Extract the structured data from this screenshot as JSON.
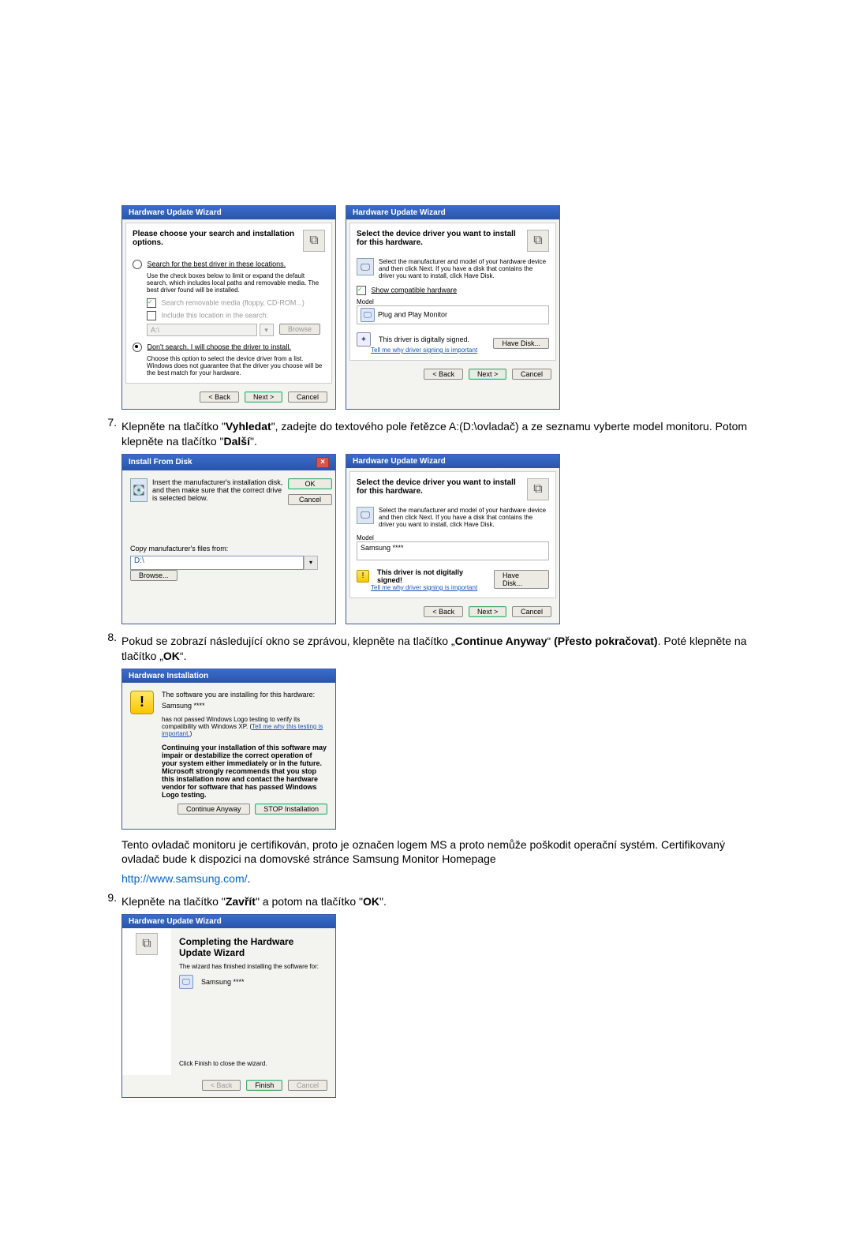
{
  "wizard_title": "Hardware Update Wizard",
  "dlg1": {
    "heading": "Please choose your search and installation options.",
    "opt_search": "Search for the best driver in these locations.",
    "opt_search_help": "Use the check boxes below to limit or expand the default search, which includes local paths and removable media. The best driver found will be installed.",
    "chk_removable": "Search removable media (floppy, CD-ROM...)",
    "chk_include": "Include this location in the search:",
    "path_value": "A:\\",
    "btn_browse": "Browse",
    "opt_dont": "Don't search. I will choose the driver to install.",
    "opt_dont_help": "Choose this option to select the device driver from a list.  Windows does not guarantee that the driver you choose will be the best match for your hardware."
  },
  "dlg2": {
    "heading": "Select the device driver you want to install for this hardware.",
    "help": "Select the manufacturer and model of your hardware device and then click Next. If you have a disk that contains the driver you want to install, click Have Disk.",
    "chk_compat": "Show compatible hardware",
    "model_label": "Model",
    "model_item": "Plug and Play Monitor",
    "signed": "This driver is digitally signed.",
    "tell_me": "Tell me why driver signing is important",
    "have_disk": "Have Disk..."
  },
  "nav": {
    "back": "< Back",
    "next": "Next >",
    "cancel": "Cancel"
  },
  "step7": {
    "num": "7.",
    "text_a": "Klepněte na tlačítko \"",
    "text_b": "Vyhledat",
    "text_c": "\", zadejte do textového pole řetězce A:(D:\\ovladač) a ze seznamu vyberte model monitoru. Potom klepněte na tlačítko \"",
    "text_d": "Další",
    "text_e": "\"."
  },
  "installdisk": {
    "title": "Install From Disk",
    "msg": "Insert the manufacturer's installation disk, and then make sure that the correct drive is selected below.",
    "ok": "OK",
    "cancel": "Cancel",
    "copy_label": "Copy manufacturer's files from:",
    "path": "D:\\",
    "browse": "Browse..."
  },
  "dlg3": {
    "heading": "Select the device driver you want to install for this hardware.",
    "help": "Select the manufacturer and model of your hardware device and then click Next. If you have a disk that contains the driver you want to install, click Have Disk.",
    "model_label": "Model",
    "model_item": "Samsung ****",
    "not_signed": "This driver is not digitally signed!",
    "tell_me": "Tell me why driver signing is important",
    "have_disk": "Have Disk..."
  },
  "step8": {
    "num": "8.",
    "text_a": "Pokud se zobrazí následující okno se zprávou, klepněte na tlačítko ",
    "q1": "„",
    "b1": "Continue Anyway",
    "q2": "“",
    "mid": " (Přesto pokračovat)",
    "text_b": ". Poté klepněte na tlačítko ",
    "q3": "„",
    "b2": "OK",
    "q4": "“",
    "dot": "."
  },
  "hwinst": {
    "title": "Hardware Installation",
    "line1": "The software you are installing for this hardware:",
    "line2": "Samsung ****",
    "line3a": "has not passed Windows Logo testing to verify its compatibility with Windows XP. (",
    "line3_link": "Tell me why this testing is important.",
    "line3b": ")",
    "bold": "Continuing your installation of this software may impair or destabilize the correct operation of your system either immediately or in the future. Microsoft strongly recommends that you stop this installation now and contact the hardware vendor for software that has passed Windows Logo testing.",
    "btn_continue": "Continue Anyway",
    "btn_stop": "STOP Installation"
  },
  "cert_text": "Tento ovladač monitoru je certifikován, proto je označen logem MS a proto nemůže poškodit operační systém. Certifikovaný ovladač bude k dispozici na domovské stránce Samsung Monitor Homepage",
  "cert_link": "http://www.samsung.com/",
  "step9": {
    "num": "9.",
    "text_a": "Klepněte na tlačítko \"",
    "b1": "Zavřít",
    "text_b": "\" a potom na tlačítko \"",
    "b2": "OK",
    "text_c": "\"."
  },
  "finish": {
    "title": "Hardware Update Wizard",
    "heading": "Completing the Hardware Update Wizard",
    "line": "The wizard has finished installing the software for:",
    "item": "Samsung ****",
    "click_finish": "Click Finish to close the wizard.",
    "back": "< Back",
    "finish_btn": "Finish",
    "cancel": "Cancel"
  }
}
